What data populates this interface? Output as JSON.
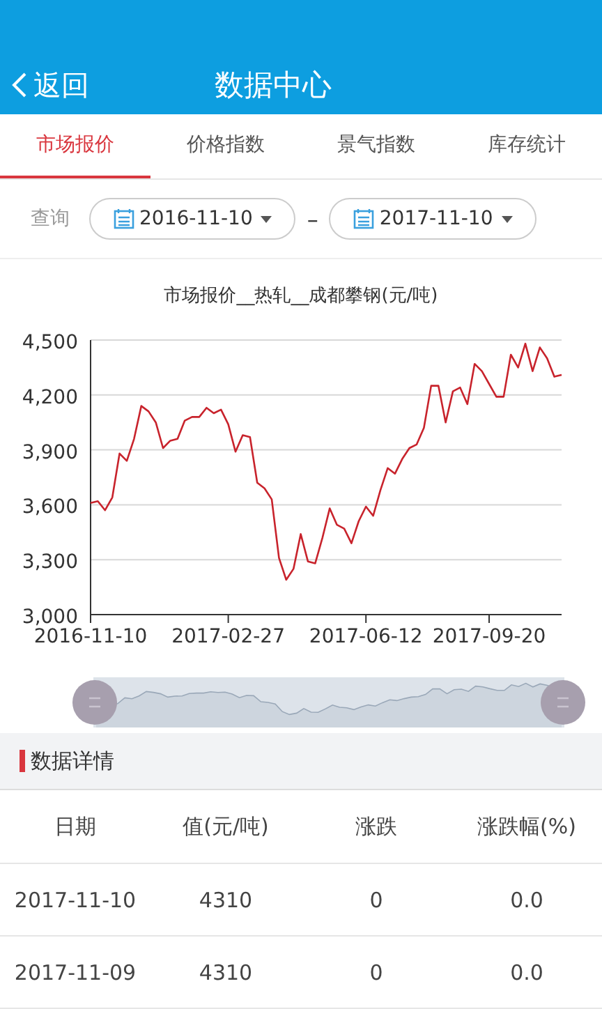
{
  "header": {
    "back": "返回",
    "title": "数据中心"
  },
  "tabs": [
    {
      "label": "市场报价",
      "selected": true
    },
    {
      "label": "价格指数",
      "selected": false
    },
    {
      "label": "景气指数",
      "selected": false
    },
    {
      "label": "库存统计",
      "selected": false
    }
  ],
  "query": {
    "label": "查询",
    "start": "2016-11-10",
    "separator": "–",
    "end": "2017-11-10"
  },
  "chart": {
    "chart_data": {
      "type": "line",
      "title": "市场报价__热轧__成都攀钢(元/吨)",
      "categories": [
        "2016-11-10",
        null,
        null,
        null,
        null,
        null,
        null,
        null,
        null,
        null,
        null,
        null,
        null,
        null,
        null,
        null,
        null,
        null,
        null,
        "2017-02-27",
        null,
        null,
        null,
        null,
        null,
        null,
        null,
        null,
        null,
        null,
        null,
        null,
        null,
        null,
        null,
        null,
        null,
        null,
        "2017-06-12",
        null,
        null,
        null,
        null,
        null,
        null,
        null,
        null,
        null,
        null,
        null,
        null,
        null,
        null,
        null,
        null,
        "2017-09-20",
        null,
        null,
        null,
        null,
        null,
        null,
        null,
        null,
        null,
        null
      ],
      "series": [
        {
          "color": "#c8232c",
          "values": [
            3610,
            3620,
            3570,
            3640,
            3880,
            3840,
            3960,
            4140,
            4110,
            4050,
            3910,
            3950,
            3960,
            4060,
            4080,
            4080,
            4130,
            4100,
            4120,
            4040,
            3890,
            3980,
            3970,
            3720,
            3690,
            3630,
            3310,
            3190,
            3250,
            3440,
            3290,
            3280,
            3420,
            3580,
            3490,
            3470,
            3390,
            3510,
            3590,
            3540,
            3680,
            3800,
            3770,
            3850,
            3910,
            3930,
            4020,
            4250,
            4250,
            4050,
            4220,
            4240,
            4150,
            4370,
            4330,
            4260,
            4190,
            4190,
            4420,
            4350,
            4480,
            4330,
            4460,
            4400,
            4300,
            4310
          ]
        }
      ],
      "ylim": [
        3000,
        4500
      ],
      "grid": true,
      "yticks": [
        {
          "value": 3000,
          "label": "3,000"
        },
        {
          "value": 3300,
          "label": "3,300"
        },
        {
          "value": 3600,
          "label": "3,600"
        },
        {
          "value": 3900,
          "label": "3,900"
        },
        {
          "value": 4200,
          "label": "4,200"
        },
        {
          "value": 4500,
          "label": "4,500"
        }
      ]
    }
  },
  "section": {
    "title": "数据详情"
  },
  "table": {
    "columns": [
      "日期",
      "值(元/吨)",
      "涨跌",
      "涨跌幅(%)"
    ],
    "rows": [
      [
        "2017-11-10",
        "4310",
        "0",
        "0.0"
      ],
      [
        "2017-11-09",
        "4310",
        "0",
        "0.0"
      ]
    ]
  }
}
